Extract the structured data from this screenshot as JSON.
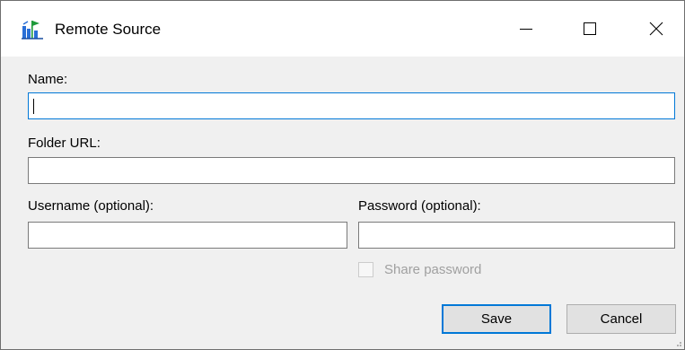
{
  "window": {
    "title": "Remote Source",
    "icon": "remote-source-app-icon",
    "controls": {
      "minimize": "minimize-icon",
      "maximize": "maximize-icon",
      "close": "close-icon"
    }
  },
  "form": {
    "name_label": "Name:",
    "name_value": "",
    "folder_url_label": "Folder URL:",
    "folder_url_value": "",
    "username_label": "Username (optional):",
    "username_value": "",
    "password_label": "Password (optional):",
    "password_value": "",
    "share_password_label": "Share password",
    "share_password_checked": false,
    "share_password_enabled": false
  },
  "buttons": {
    "save_label": "Save",
    "cancel_label": "Cancel"
  },
  "colors": {
    "focus_accent": "#0078d7",
    "disabled_text": "#a0a0a0",
    "icon_green": "#1e9a3a",
    "icon_blue": "#2a6fd6"
  }
}
